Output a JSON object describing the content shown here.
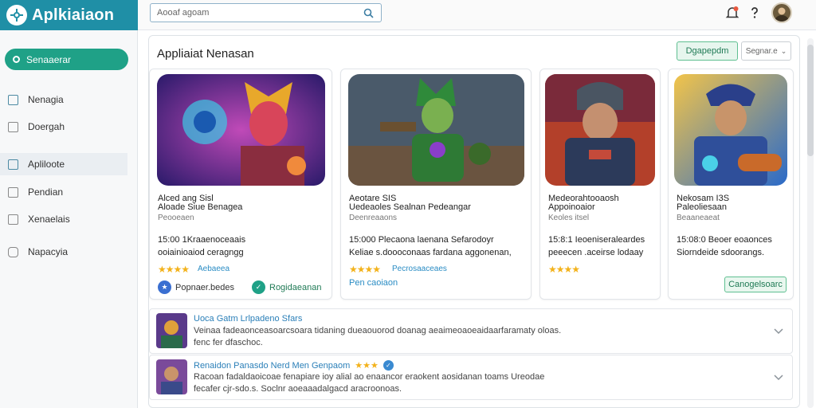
{
  "app": {
    "name": "Aplkiaiaon"
  },
  "search": {
    "placeholder": "Aooaf agoam"
  },
  "header": {
    "notification_icon": "bell-icon",
    "help_icon": "help-icon"
  },
  "sidebar": {
    "primary": "Senaaerar",
    "items": [
      {
        "label": "Nenagia",
        "icon": "book-icon"
      },
      {
        "label": "Doergah",
        "icon": "square-icon"
      },
      {
        "label": "Apliloote",
        "icon": "app-icon",
        "active": true
      },
      {
        "label": "Pendian",
        "icon": "mail-icon"
      },
      {
        "label": "Xenaelais",
        "icon": "layers-icon"
      },
      {
        "label": "Napacyia",
        "icon": "shield-icon"
      }
    ]
  },
  "main": {
    "title": "Appliaiat Nenasan",
    "btn_green": "Dgapepdm",
    "btn_select": "Segnar.e"
  },
  "cards": [
    {
      "t1": "Alced ang Sisl",
      "t2": "Aloade Siue Benagea",
      "t3": "Peooeaen",
      "d1": "15:00  1Kraaenoceaais",
      "d2": "ooiainioaiod ceragngg",
      "stars": "★★★★",
      "rating": "Aebaeea",
      "foot_a": "Popnaer.bedes",
      "foot_b": "Rogidaeanan"
    },
    {
      "t1": "Aeotare SIS",
      "t2": "Uedeaoles Sealnan Pedeangar",
      "t3": "Deenreaaons",
      "d1": "15:000  Plecaona laenana Sefarodoyr",
      "d2": "Keliae s.doooconaas  fardana aggonenan,",
      "stars": "★★★★",
      "rating": "Pecrosaaceaes",
      "foot_a": "Pen caoiaon"
    },
    {
      "t1": "Medeorahtooaosh",
      "t2": "Appoinoaior",
      "t3": "Keoles itsel",
      "d1": "15:8:1  Ieoeniseraleardes",
      "d2": "peeecen .aceirse lodaay",
      "stars": "★★★★"
    },
    {
      "t1": "Nekosam  I3S",
      "t2": "Paleoliesaan",
      "t3": "Beaaneaeat",
      "d1": "15:08:0 Beoer eoaonces",
      "d2": "Siorndeide sdoorangs.",
      "button": "Canogelsoarc"
    }
  ],
  "list": [
    {
      "title": "Uoca Gatm Lrlpadeno Sfars",
      "d1": "Veinaa fadeaonceasoarcsoara tidaning dueaouorod doanag aeaimeoaoeaidaarfaramaty oloas.",
      "d2": "fenc fer dfaschoc."
    },
    {
      "title": "Renaidon Panasdo Nerd Men Genpaom",
      "stars": "★★★",
      "d1": "Racoan fadaldaoicoae fenapiare ioy alial ao enaancor eraokent aosidanan toams Ureodae",
      "d2": "fecafer cjr-sdo.s.  Soclnr aoeaaadalgacd aracroonoas."
    }
  ],
  "colors": {
    "brand": "#1f8fa6",
    "accent": "#1fa187",
    "star": "#f3b21b",
    "link": "#2a8cc4"
  }
}
